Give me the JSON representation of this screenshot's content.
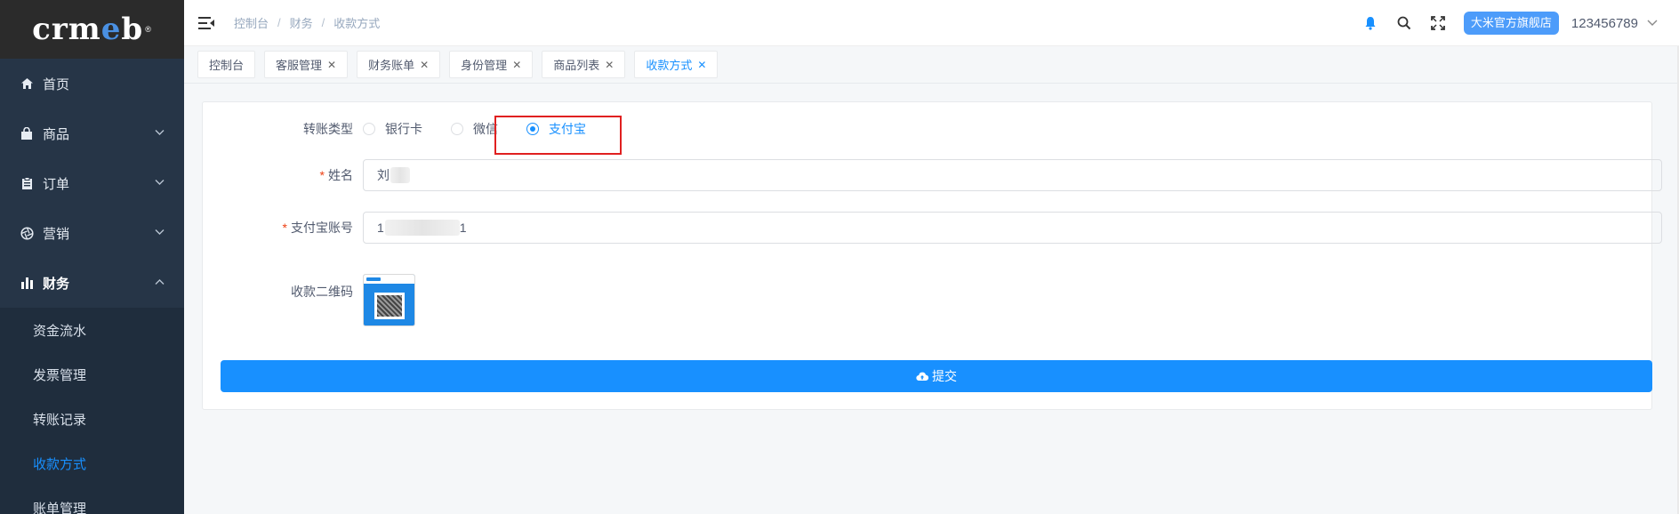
{
  "app": {
    "logo_text_left": "crm",
    "logo_text_blue": "e",
    "logo_text_right": "b",
    "logo_tm": "®"
  },
  "sidebar": {
    "items": [
      {
        "label": "首页",
        "icon": "home-icon",
        "has_arrow": false
      },
      {
        "label": "商品",
        "icon": "bag-icon",
        "has_arrow": true
      },
      {
        "label": "订单",
        "icon": "clipboard-icon",
        "has_arrow": true
      },
      {
        "label": "营销",
        "icon": "aperture-icon",
        "has_arrow": true
      },
      {
        "label": "财务",
        "icon": "bar-chart-icon",
        "has_arrow": true,
        "open": true
      }
    ],
    "sub_items": [
      {
        "label": "资金流水",
        "active": false
      },
      {
        "label": "发票管理",
        "active": false
      },
      {
        "label": "转账记录",
        "active": false
      },
      {
        "label": "收款方式",
        "active": true
      },
      {
        "label": "账单管理",
        "active": false
      }
    ]
  },
  "header": {
    "breadcrumb": [
      "控制台",
      "财务",
      "收款方式"
    ],
    "store_label": "大米官方旗舰店",
    "username": "123456789"
  },
  "tags": [
    {
      "label": "控制台",
      "closable": false,
      "active": false
    },
    {
      "label": "客服管理",
      "closable": true,
      "active": false
    },
    {
      "label": "财务账单",
      "closable": true,
      "active": false
    },
    {
      "label": "身份管理",
      "closable": true,
      "active": false
    },
    {
      "label": "商品列表",
      "closable": true,
      "active": false
    },
    {
      "label": "收款方式",
      "closable": true,
      "active": true
    }
  ],
  "form": {
    "transfer_type_label": "转账类型",
    "transfer_options": [
      "银行卡",
      "微信",
      "支付宝"
    ],
    "selected_option": "支付宝",
    "name_label": "姓名",
    "name_value_visible": "刘",
    "account_label": "支付宝账号",
    "account_value_start": "1",
    "account_value_end": "1",
    "qr_label": "收款二维码",
    "submit_label": "提交"
  },
  "colors": {
    "primary": "#1890ff",
    "sidebar_bg": "#263547",
    "highlight_border": "#e02020",
    "store_btn": "#4d9cfa"
  }
}
